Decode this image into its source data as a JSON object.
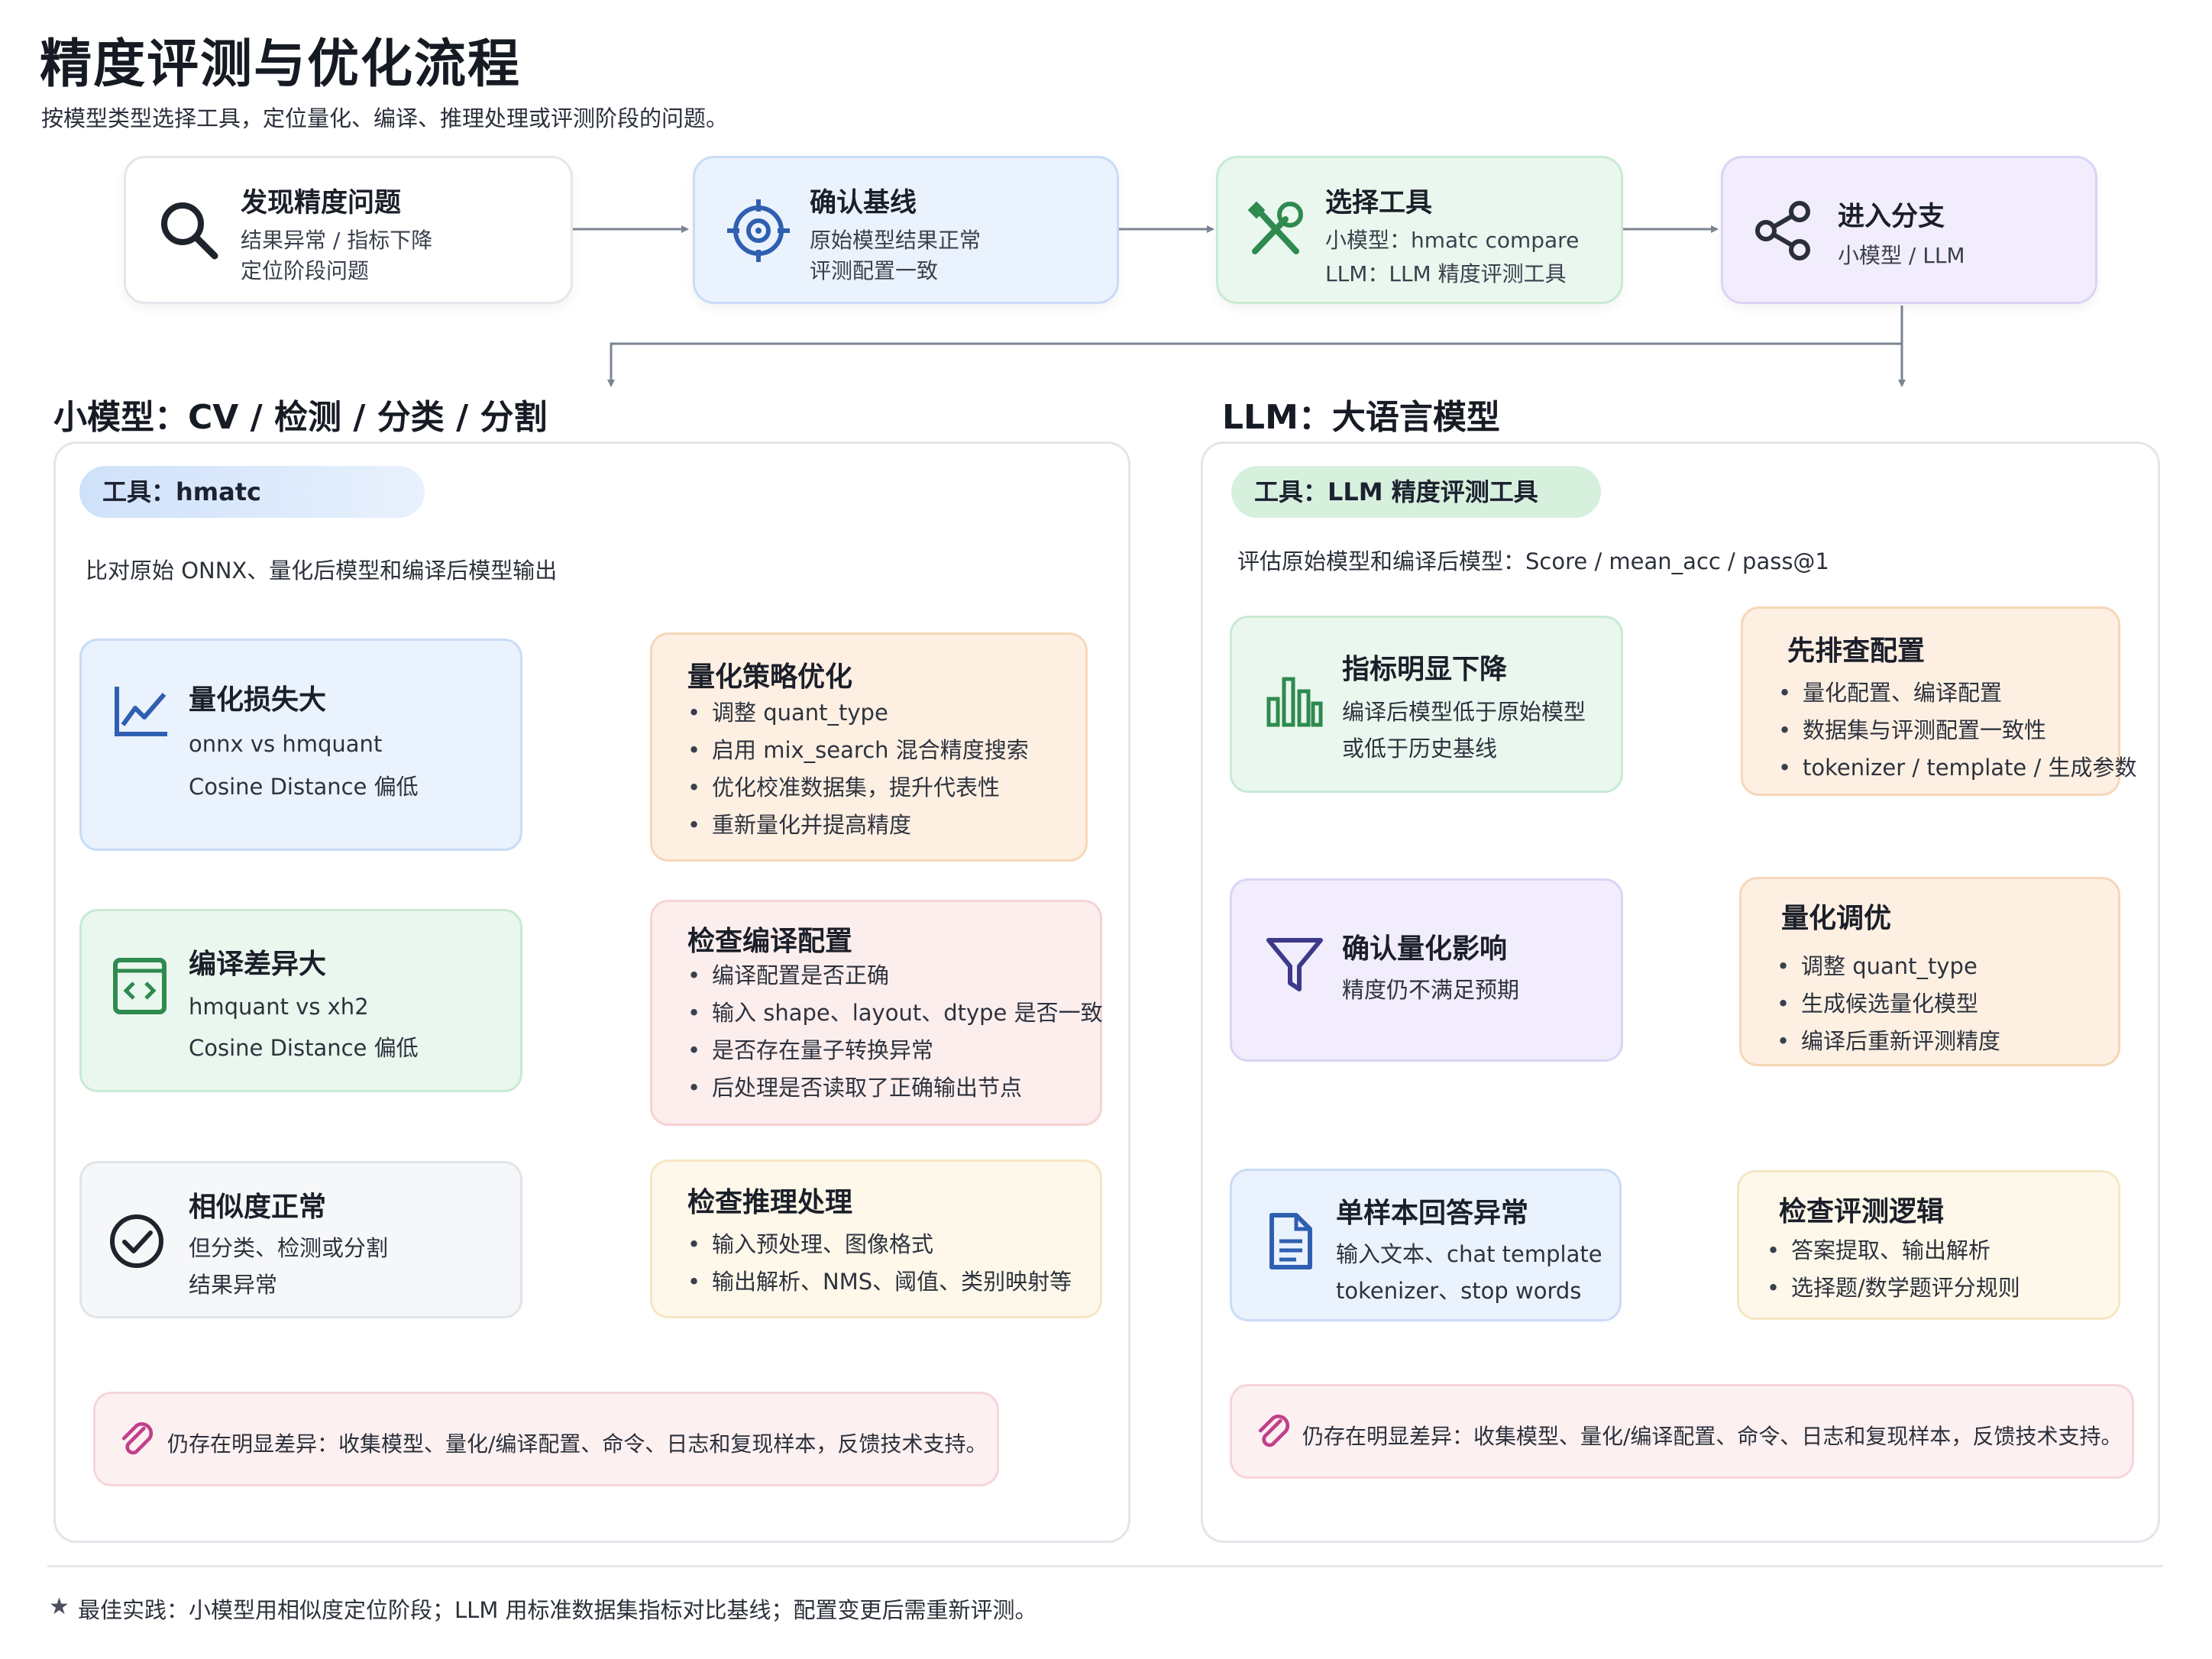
{
  "title": "精度评测与优化流程",
  "subtitle": "按模型类型选择工具，定位量化、编译、推理处理或评测阶段的问题。",
  "colors": {
    "blue_bg": "#eaf2fd",
    "blue_border": "#c9dcf6",
    "green_bg": "#eaf7ee",
    "green_border": "#c8ead3",
    "purple_bg": "#f1edfc",
    "purple_border": "#dcd3f5",
    "orange_bg": "#fdf0e3",
    "orange_border": "#f6d7b8",
    "pink_bg": "#fdeeee",
    "pink_border": "#f6d3d3",
    "yellow_bg": "#fef8ea",
    "yellow_border": "#f6e6c3",
    "gray_bg": "#f6f7f9",
    "gray_border": "#e1e4e9",
    "arrow": "#7b8592"
  },
  "steps": [
    {
      "icon": "search-icon",
      "title": "发现精度问题",
      "lines": [
        "结果异常 / 指标下降",
        "定位阶段问题"
      ]
    },
    {
      "icon": "target-icon",
      "title": "确认基线",
      "lines": [
        "原始模型结果正常",
        "评测配置一致"
      ]
    },
    {
      "icon": "tools-icon",
      "title": "选择工具",
      "lines": [
        "小模型：hmatc compare",
        "LLM：LLM 精度评测工具"
      ]
    },
    {
      "icon": "share-icon",
      "title": "进入分支",
      "lines": [
        "小模型 / LLM"
      ]
    }
  ],
  "left": {
    "section_title": "小模型：CV / 检测 / 分类 / 分割",
    "tool_label": "工具：hmatc",
    "description": "比对原始 ONNX、量化后模型和编译后模型输出",
    "rows": [
      {
        "problem": {
          "icon": "line-chart-icon",
          "title": "量化损失大",
          "lines": [
            "onnx vs hmquant",
            "Cosine Distance 偏低"
          ]
        },
        "action": {
          "title": "量化策略优化",
          "items": [
            "调整 quant_type",
            "启用 mix_search 混合精度搜索",
            "优化校准数据集，提升代表性",
            "重新量化并提高精度"
          ]
        }
      },
      {
        "problem": {
          "icon": "code-icon",
          "title": "编译差异大",
          "lines": [
            "hmquant vs xh2",
            "Cosine Distance 偏低"
          ]
        },
        "action": {
          "title": "检查编译配置",
          "items": [
            "编译配置是否正确",
            "输入 shape、layout、dtype 是否一致",
            "是否存在量子转换异常",
            "后处理是否读取了正确输出节点"
          ]
        }
      },
      {
        "problem": {
          "icon": "check-circle-icon",
          "title": "相似度正常",
          "lines": [
            "但分类、检测或分割",
            "结果异常"
          ]
        },
        "action": {
          "title": "检查推理处理",
          "items": [
            "输入预处理、图像格式",
            "输出解析、NMS、阈值、类别映射等"
          ]
        }
      }
    ],
    "note": "仍存在明显差异：收集模型、量化/编译配置、命令、日志和复现样本，反馈技术支持。"
  },
  "right": {
    "section_title": "LLM：大语言模型",
    "tool_label": "工具：LLM 精度评测工具",
    "description": "评估原始模型和编译后模型：Score / mean_acc / pass@1",
    "rows": [
      {
        "problem": {
          "icon": "bar-chart-icon",
          "title": "指标明显下降",
          "lines": [
            "编译后模型低于原始模型",
            "或低于历史基线"
          ]
        },
        "action": {
          "title": "先排查配置",
          "items": [
            "量化配置、编译配置",
            "数据集与评测配置一致性",
            "tokenizer / template / 生成参数"
          ]
        }
      },
      {
        "problem": {
          "icon": "filter-icon",
          "title": "确认量化影响",
          "lines": [
            "精度仍不满足预期"
          ]
        },
        "action": {
          "title": "量化调优",
          "items": [
            "调整 quant_type",
            "生成候选量化模型",
            "编译后重新评测精度"
          ]
        }
      },
      {
        "problem": {
          "icon": "document-icon",
          "title": "单样本回答异常",
          "lines": [
            "输入文本、chat template",
            "tokenizer、stop words"
          ]
        },
        "action": {
          "title": "检查评测逻辑",
          "items": [
            "答案提取、输出解析",
            "选择题/数学题评分规则"
          ]
        }
      }
    ],
    "note": "仍存在明显差异：收集模型、量化/编译配置、命令、日志和复现样本，反馈技术支持。"
  },
  "footer": "最佳实践：小模型用相似度定位阶段；LLM 用标准数据集指标对比基线；配置变更后需重新评测。"
}
